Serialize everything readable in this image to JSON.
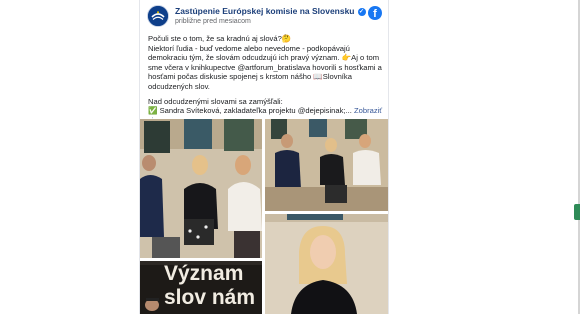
{
  "post": {
    "page_name": "Zastúpenie Európskej komisie na Slovensku",
    "verified_mark": "✓",
    "time": "približne pred mesiacom",
    "platform_icon": "facebook-icon",
    "lines": [
      "Počuli ste o tom, že sa kradnú aj slová?🤔",
      "Niektorí ľudia - buď vedome alebo nevedome - podkopávajú demokraciu tým, že slovám odcudzujú ich pravý význam. 👉Aj o tom sme včera v knihkupectve @artforum_bratislava hovorili s hosťkami a hosťami počas diskusie spojenej s krstom nášho 📖Slovníka odcudzených slov.",
      "Nad odcudzenými slovami sa zamýšľali:"
    ],
    "last_line": "✅ Sandra Svíteková, zakladateľka projektu @dejepisinak;...",
    "see_more": "Zobraziť viac",
    "banner_text": [
      "Význam",
      "slov nám"
    ]
  },
  "colors": {
    "link": "#385898",
    "page_name": "#1c3f7a",
    "facebook_blue": "#1877f2",
    "eu_navy": "#0e3f8a"
  }
}
